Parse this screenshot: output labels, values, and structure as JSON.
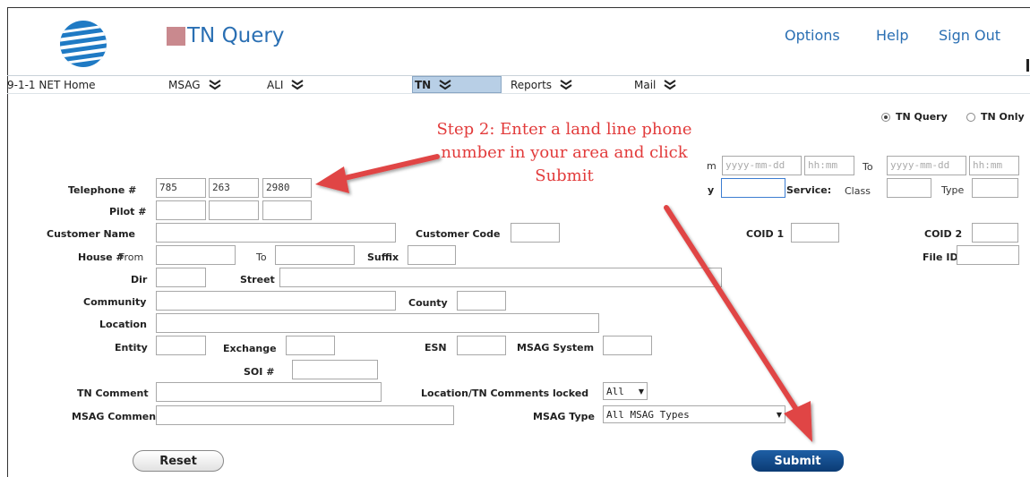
{
  "header": {
    "title": "TN Query",
    "links": [
      "Options",
      "Help",
      "Sign Out"
    ]
  },
  "nav": {
    "items": [
      {
        "label": "9-1-1 NET Home",
        "dropdown": false
      },
      {
        "label": "MSAG",
        "dropdown": true
      },
      {
        "label": "ALI",
        "dropdown": true
      },
      {
        "label": "TN",
        "dropdown": true,
        "active": true
      },
      {
        "label": "Reports",
        "dropdown": true
      },
      {
        "label": "Mail",
        "dropdown": true
      }
    ]
  },
  "mode": {
    "options": [
      "TN Query",
      "TN Only"
    ],
    "selected": "TN Query"
  },
  "date_range": {
    "from_label": "m",
    "date_placeholder": "yyyy-mm-dd",
    "time_placeholder": "hh:mm",
    "to_label": "To"
  },
  "form": {
    "telephone_label": "Telephone #",
    "telephone": [
      "785",
      "263",
      "2980"
    ],
    "pilot_label": "Pilot #",
    "customer_name_label": "Customer Name",
    "customer_code_label": "Customer Code",
    "coid1_label": "COID 1",
    "coid2_label": "COID 2",
    "house_label": "House #",
    "from_label": "From",
    "to_label": "To",
    "suffix_label": "Suffix",
    "file_id_label": "File ID",
    "dir_label": "Dir",
    "street_label": "Street",
    "community_label": "Community",
    "county_label": "County",
    "location_label": "Location",
    "entity_label": "Entity",
    "exchange_label": "Exchange",
    "esn_label": "ESN",
    "msag_system_label": "MSAG System",
    "soi_label": "SOI #",
    "tn_comment_label": "TN Comment",
    "locked_label": "Location/TN Comments locked",
    "locked_value": "All",
    "msag_comment_label": "MSAG Comment",
    "msag_type_label": "MSAG Type",
    "msag_type_value": "All MSAG Types",
    "by_label": "y",
    "service_label": "Service:",
    "class_label": "Class",
    "type_label": "Type"
  },
  "buttons": {
    "reset": "Reset",
    "submit": "Submit"
  },
  "annotation": {
    "text": "Step 2:  Enter a land line phone number in your area and click Submit",
    "color": "#e23b3b"
  },
  "colors": {
    "brand_blue": "#2a6fb3",
    "submit_blue": "#0b3b74"
  }
}
